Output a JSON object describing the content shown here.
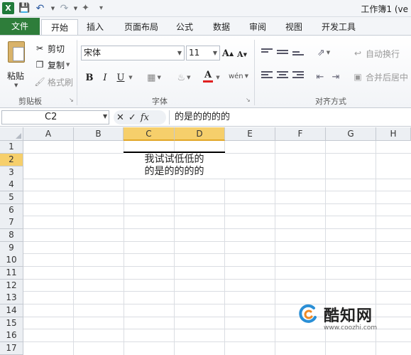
{
  "titlebar": {
    "excel_logo": "X",
    "title": "工作簿1 (ve"
  },
  "tabs": [
    "文件",
    "开始",
    "插入",
    "页面布局",
    "公式",
    "数据",
    "审阅",
    "视图",
    "开发工具"
  ],
  "ribbon": {
    "clipboard": {
      "paste": "粘贴",
      "cut": "剪切",
      "copy": "复制",
      "format_painter": "格式刷",
      "group_label": "剪贴板"
    },
    "font": {
      "font_name": "宋体",
      "font_size": "11",
      "bold": "B",
      "italic": "I",
      "underline": "U",
      "font_color_glyph": "A",
      "phonetic": "wén",
      "group_label": "字体",
      "accent_red": "#e02020",
      "grow": "A",
      "shrink": "A"
    },
    "alignment": {
      "wrap_text": "自动换行",
      "merge_center": "合并后居中",
      "group_label": "对齐方式"
    }
  },
  "formula_bar": {
    "name_box": "C2",
    "cancel": "✕",
    "enter": "✓",
    "fx": "fx",
    "content": "的是的的的的"
  },
  "grid": {
    "columns": [
      "A",
      "B",
      "C",
      "D",
      "E",
      "F",
      "G",
      "H"
    ],
    "selected_columns": [
      "C",
      "D"
    ],
    "rows": [
      "1",
      "2",
      "3",
      "4",
      "5",
      "6",
      "7",
      "8",
      "9",
      "10",
      "11",
      "12",
      "13",
      "14",
      "15",
      "16",
      "17"
    ],
    "selected_row": "2",
    "merged_cell_lines": [
      "我试试低低的",
      "的是的的的的"
    ]
  },
  "watermark": {
    "name": "酷知网",
    "url": "www.coozhi.com"
  }
}
